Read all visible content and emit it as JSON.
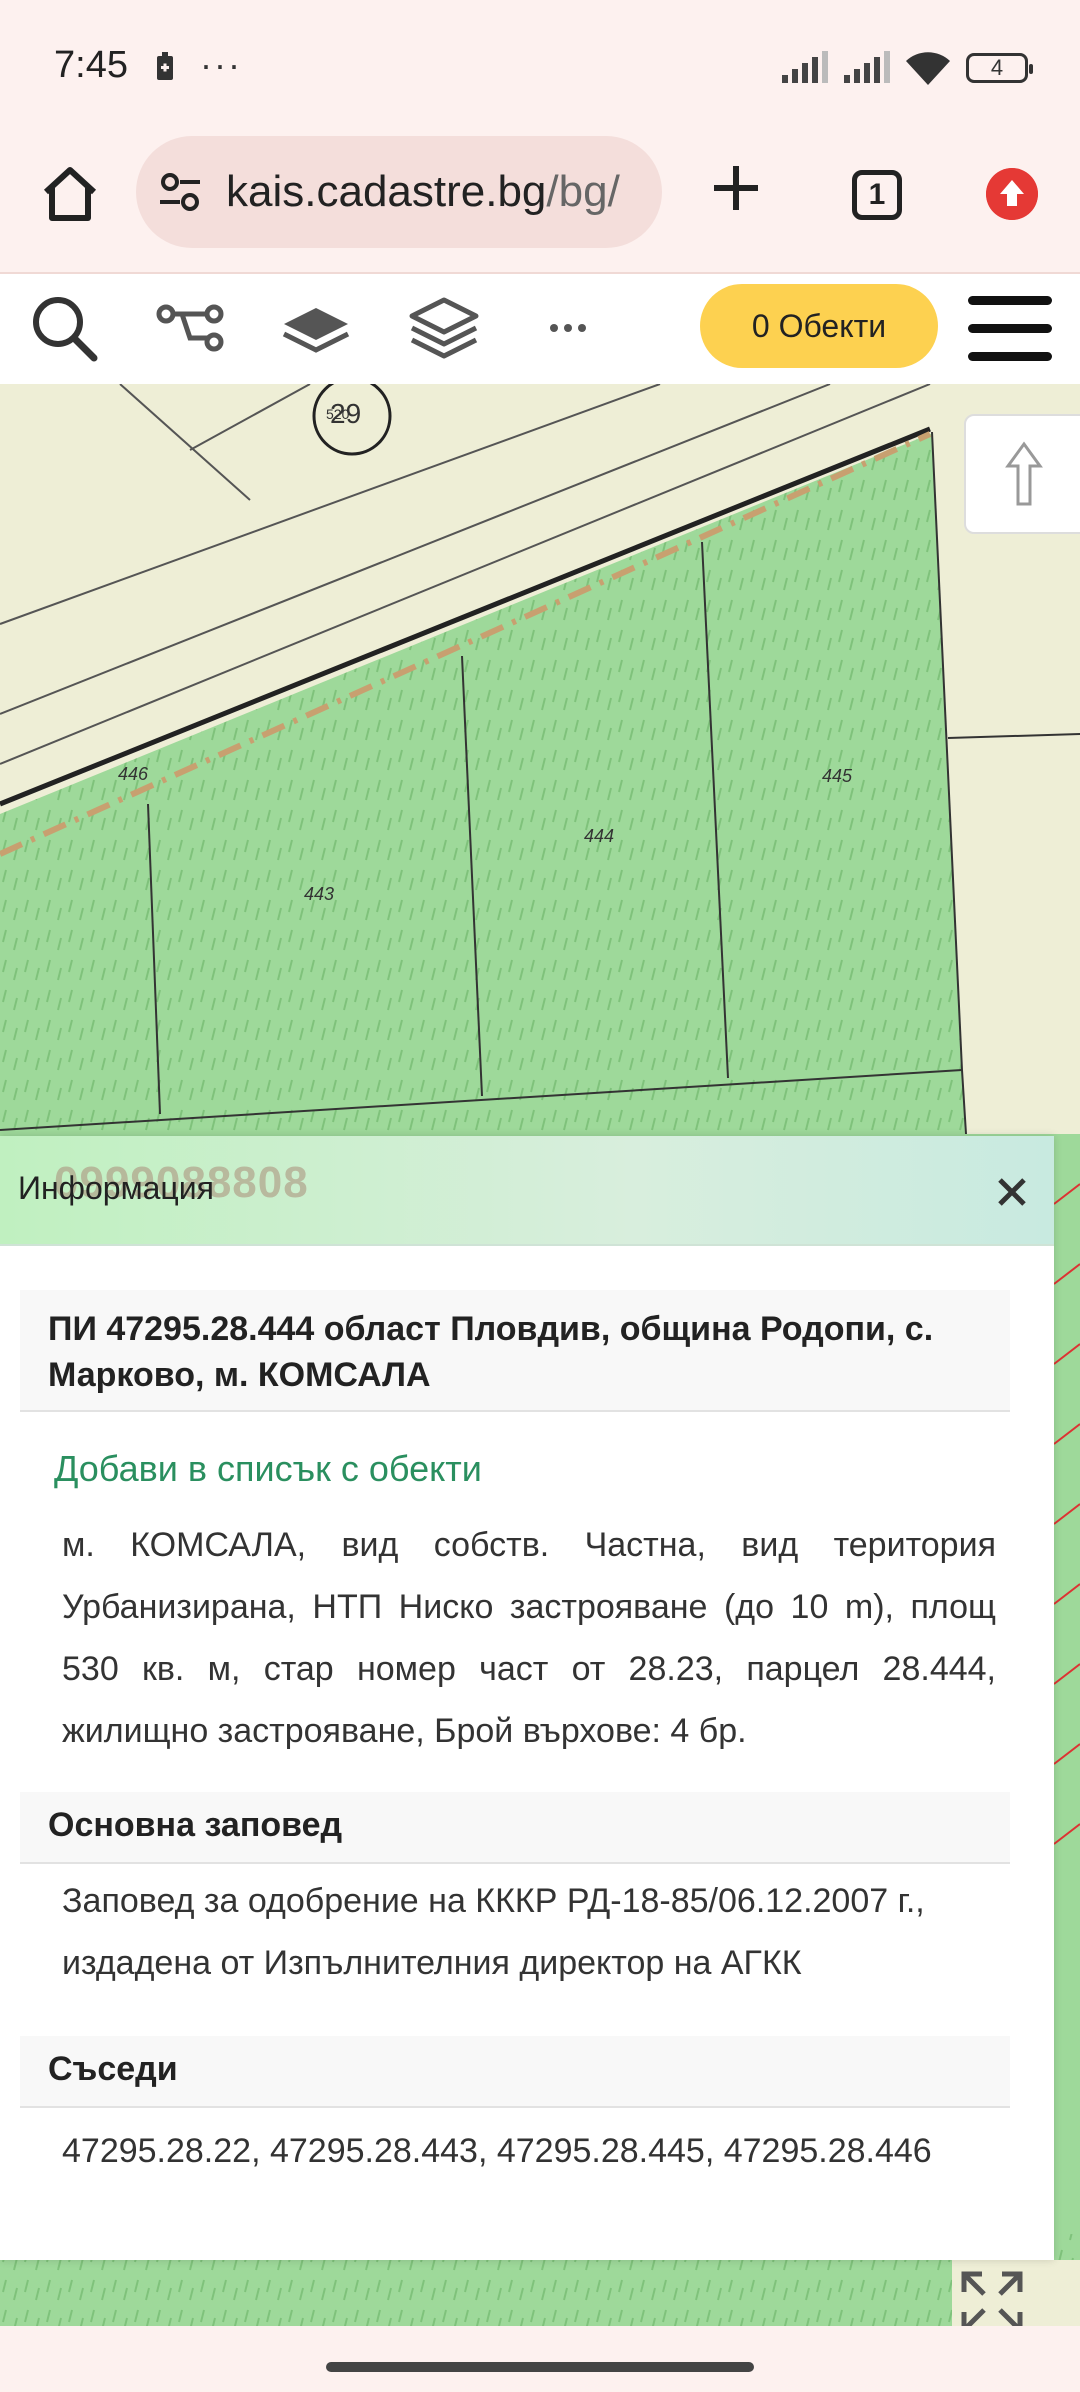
{
  "status_bar": {
    "time": "7:45",
    "dots": "···",
    "battery": "4"
  },
  "browser": {
    "url_host": "kais.cadastre.bg",
    "url_path": "/bg/",
    "tab_count": "1"
  },
  "site_toolbar": {
    "objects_button": "0 Обекти"
  },
  "map": {
    "labels": {
      "circle_number": "29",
      "circle_small": "520",
      "p446": "446",
      "p443": "443",
      "p444": "444",
      "p445": "445"
    }
  },
  "info_panel": {
    "title": "Информация",
    "watermark": "0999088808",
    "parcel_title": "ПИ 47295.28.444 област Пловдив, община Родопи, с. Марково, м. КОМСАЛА",
    "add_link": "Добави в списък с обекти",
    "description": "м. КОМСАЛА, вид собств. Частна, вид територия Урбанизирана, НТП Ниско застрояване (до 10 m), площ 530 кв. м, стар номер част от 28.23, парцел 28.444, жилищно застрояване, Брой върхове: 4 бр.",
    "order_heading": "Основна заповед",
    "order_text": "Заповед за одобрение на КККР РД-18-85/06.12.2007 г., издадена от Изпълнителния директор на АГКК",
    "neighbours_heading": "Съседи",
    "neighbours_text": "47295.28.22, 47295.28.443, 47295.28.445, 47295.28.446"
  },
  "colors": {
    "parcel_fill": "#9ed99a",
    "objects_button": "#fdd150",
    "link_green": "#2a8f5f"
  }
}
